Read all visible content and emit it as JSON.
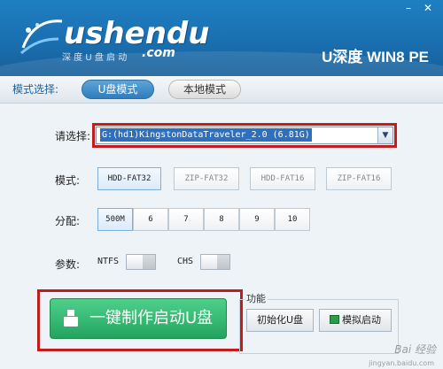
{
  "app": {
    "logo_main": "ushendu",
    "logo_sub": "深 度 U 盘 启 动",
    "logo_suffix": ".com",
    "title": "U深度 WIN8 PE",
    "minimize": "–",
    "close": "✕"
  },
  "mode_bar": {
    "label": "模式选择:",
    "tabs": [
      "U盘模式",
      "本地模式"
    ]
  },
  "device": {
    "label": "请选择:",
    "selected": "G:(hd1)KingstonDataTraveler_2.0 (6.81G)"
  },
  "format": {
    "label": "模式:",
    "options": [
      "HDD-FAT32",
      "ZIP-FAT32",
      "HDD-FAT16",
      "ZIP-FAT16"
    ]
  },
  "alloc": {
    "label": "分配:",
    "options": [
      "500M",
      "6",
      "7",
      "8",
      "9",
      "10"
    ]
  },
  "params": {
    "label": "参数:",
    "ntfs": "NTFS",
    "chs": "CHS"
  },
  "actions": {
    "make_button": "一键制作启动U盘",
    "group_title": "功能",
    "init_button": "初始化U盘",
    "simulate_button": "模拟启动"
  },
  "watermark": {
    "text": "Bai 经验",
    "url": "jingyan.baidu.com"
  }
}
